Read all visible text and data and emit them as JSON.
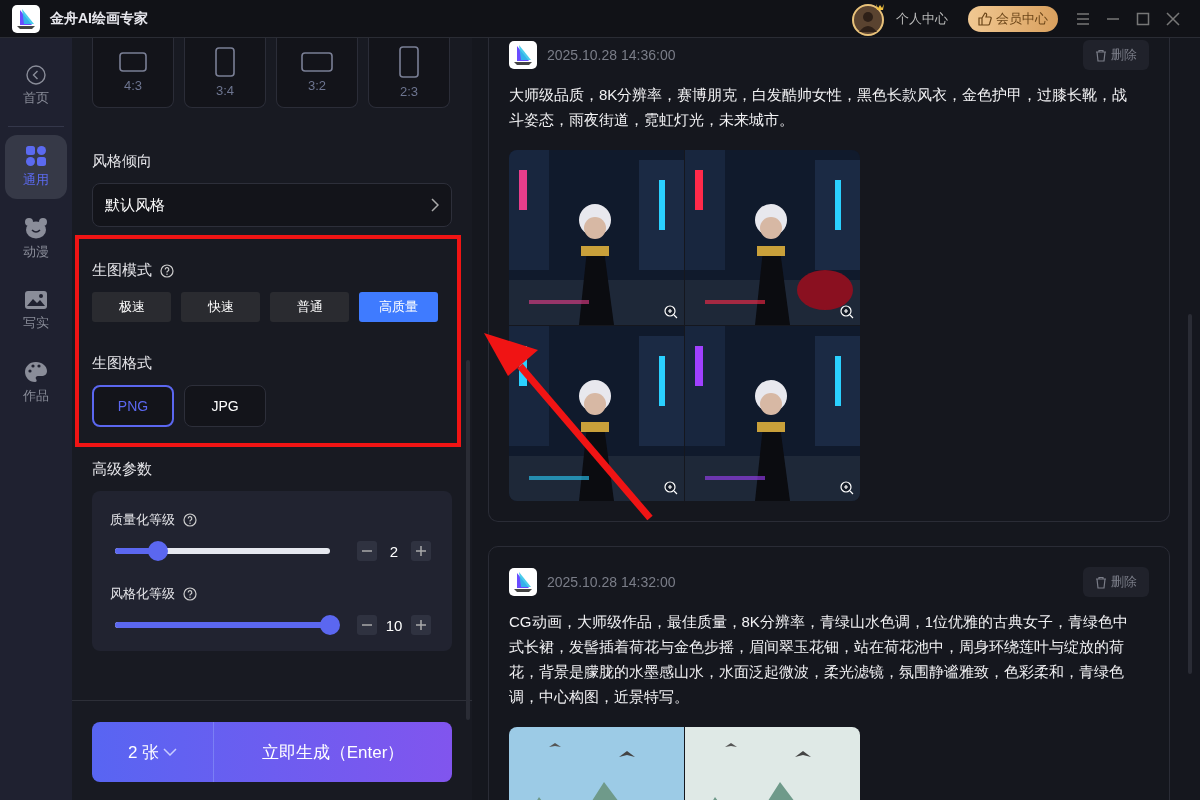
{
  "app": {
    "title": "金舟AI绘画专家"
  },
  "header": {
    "user_label": "个人中心",
    "vip_button": "会员中心"
  },
  "sidebar": {
    "back": "首页",
    "items": [
      {
        "label": "通用",
        "selected": true
      },
      {
        "label": "动漫",
        "selected": false
      },
      {
        "label": "写实",
        "selected": false
      },
      {
        "label": "作品",
        "selected": false
      }
    ]
  },
  "aspect_ratios": [
    {
      "label": "4:3",
      "kind": "landscape"
    },
    {
      "label": "3:4",
      "kind": "portrait"
    },
    {
      "label": "3:2",
      "kind": "wide"
    },
    {
      "label": "2:3",
      "kind": "tall"
    }
  ],
  "style": {
    "label": "风格倾向",
    "value": "默认风格"
  },
  "mode": {
    "label": "生图模式",
    "options": [
      {
        "label": "极速",
        "selected": false
      },
      {
        "label": "快速",
        "selected": false
      },
      {
        "label": "普通",
        "selected": false
      },
      {
        "label": "高质量",
        "selected": true
      }
    ]
  },
  "format": {
    "label": "生图格式",
    "options": [
      {
        "label": "PNG",
        "selected": true
      },
      {
        "label": "JPG",
        "selected": false
      }
    ]
  },
  "advanced": {
    "label": "高级参数",
    "params": [
      {
        "label": "质量化等级",
        "level": 0.2,
        "value": "2"
      },
      {
        "label": "风格化等级",
        "level": 1,
        "value": "10"
      }
    ]
  },
  "generate": {
    "count": "2 张",
    "button": "立即生成（Enter）"
  },
  "history": [
    {
      "time": "2025.10.28 14:36:00",
      "delete": "删除",
      "prompt": "大师级品质，8K分辨率，赛博朋克，白发酷帅女性，黑色长款风衣，金色护甲，过膝长靴，战斗姿态，雨夜街道，霓虹灯光，未来城市。"
    },
    {
      "time": "2025.10.28 14:32:00",
      "delete": "删除",
      "prompt": "CG动画，大师级作品，最佳质量，8K分辨率，青绿山水色调，1位优雅的古典女子，青绿色中式长裙，发髻插着荷花与金色步摇，眉间翠玉花钿，站在荷花池中，周身环绕莲叶与绽放的荷花，背景是朦胧的水墨感山水，水面泛起微波，柔光滤镜，氛围静谧雅致，色彩柔和，青绿色调，中心构图，近景特写。"
    }
  ]
}
